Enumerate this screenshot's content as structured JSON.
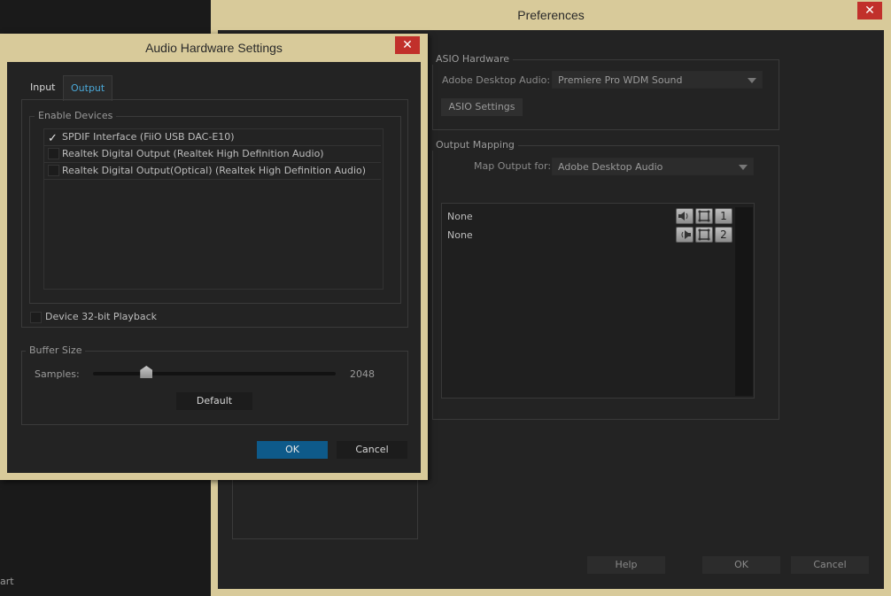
{
  "background_app": {
    "partial_text": "art"
  },
  "preferences": {
    "title": "Preferences",
    "close_glyph": "✕",
    "asio_hardware": {
      "group_label": "ASIO Hardware",
      "device_label": "Adobe Desktop Audio:",
      "device_value": "Premiere Pro WDM Sound",
      "settings_button": "ASIO Settings"
    },
    "output_mapping": {
      "group_label": "Output Mapping",
      "map_label": "Map Output for:",
      "map_value": "Adobe Desktop Audio",
      "rows": [
        {
          "label": "None",
          "channel": "1",
          "speaker_icon": "speaker-left-icon",
          "frame_icon": "frame-icon"
        },
        {
          "label": "None",
          "channel": "2",
          "speaker_icon": "speaker-right-icon",
          "frame_icon": "frame-icon"
        }
      ]
    },
    "footer": {
      "help": "Help",
      "ok": "OK",
      "cancel": "Cancel"
    }
  },
  "audio_hardware_settings": {
    "title": "Audio Hardware Settings",
    "close_glyph": "✕",
    "tabs": [
      {
        "label": "Input",
        "active": false
      },
      {
        "label": "Output",
        "active": true
      }
    ],
    "enable_devices": {
      "group_label": "Enable Devices",
      "devices": [
        {
          "label": "SPDIF Interface (FiiO USB DAC-E10)",
          "checked": true
        },
        {
          "label": "Realtek Digital Output (Realtek High Definition Audio)",
          "checked": false
        },
        {
          "label": "Realtek Digital Output(Optical) (Realtek High Definition Audio)",
          "checked": false
        }
      ],
      "check_glyph": "✓"
    },
    "playback_option": {
      "label": "Device 32-bit Playback",
      "checked": false
    },
    "buffer_size": {
      "group_label": "Buffer Size",
      "samples_label": "Samples:",
      "samples_value": "2048",
      "slider_fraction": 0.22,
      "default_button": "Default"
    },
    "footer": {
      "ok": "OK",
      "cancel": "Cancel"
    }
  },
  "colors": {
    "accent": "#0e5a8a",
    "title_bar": "#d8ca9a",
    "close": "#c1302b",
    "link_tab": "#4aa8d8"
  }
}
